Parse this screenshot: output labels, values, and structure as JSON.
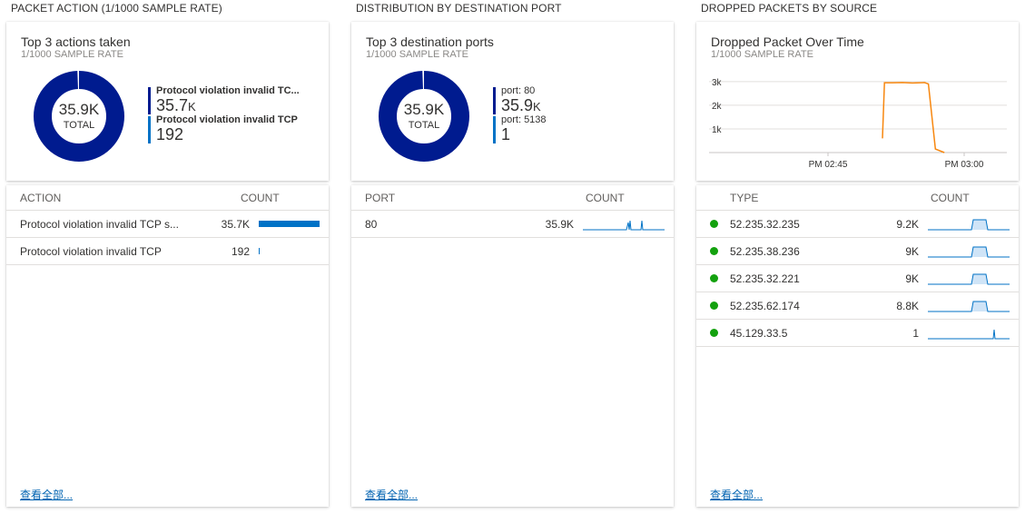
{
  "sections": [
    {
      "title": "PACKET ACTION (1/1000 SAMPLE RATE)",
      "card": {
        "title": "Top 3 actions taken",
        "subtitle": "1/1000 SAMPLE RATE",
        "donut": {
          "value": "35.9K",
          "label": "TOTAL"
        },
        "legend": [
          {
            "name": "Protocol violation invalid TC...",
            "value": "35.7",
            "unit": "K",
            "color": "#001b8f"
          },
          {
            "name": "Protocol violation invalid TCP",
            "value": "192",
            "unit": "",
            "color": "#0072c6"
          }
        ]
      },
      "table": {
        "col1": "ACTION",
        "col2": "COUNT",
        "rows": [
          {
            "name": "Protocol violation invalid TCP s...",
            "count": "35.7K",
            "bar_fraction": 0.995
          },
          {
            "name": "Protocol violation invalid TCP",
            "count": "192",
            "bar_fraction": 0.005
          }
        ],
        "view_all": "查看全部..."
      }
    },
    {
      "title": "DISTRIBUTION BY DESTINATION PORT",
      "card": {
        "title": "Top 3 destination ports",
        "subtitle": "1/1000 SAMPLE RATE",
        "donut": {
          "value": "35.9K",
          "label": "TOTAL"
        },
        "legend": [
          {
            "name": "port: 80",
            "value": "35.9",
            "unit": "K",
            "color": "#001b8f"
          },
          {
            "name": "port: 5138",
            "value": "1",
            "unit": "",
            "color": "#0072c6"
          }
        ]
      },
      "table": {
        "col1": "PORT",
        "col2": "COUNT",
        "rows": [
          {
            "name": "80",
            "count": "35.9K",
            "spark": "port"
          }
        ],
        "view_all": "查看全部..."
      }
    },
    {
      "title": "DROPPED PACKETS BY SOURCE",
      "card": {
        "title": "Dropped Packet Over Time",
        "subtitle": "1/1000 SAMPLE RATE"
      },
      "table": {
        "col1": "TYPE",
        "col2": "COUNT",
        "rows": [
          {
            "name": "52.235.32.235",
            "count": "9.2K",
            "spark": "plateau"
          },
          {
            "name": "52.235.38.236",
            "count": "9K",
            "spark": "plateau"
          },
          {
            "name": "52.235.32.221",
            "count": "9K",
            "spark": "plateau"
          },
          {
            "name": "52.235.62.174",
            "count": "8.8K",
            "spark": "plateau"
          },
          {
            "name": "45.129.33.5",
            "count": "1",
            "spark": "spike"
          }
        ],
        "view_all": "查看全部..."
      }
    }
  ],
  "chart_data": {
    "type": "line",
    "y_ticks": [
      "1k",
      "2k",
      "3k"
    ],
    "ylim": [
      0,
      3300
    ],
    "x_ticks": [
      "PM 02:45",
      "PM 03:00"
    ],
    "series": [
      {
        "color": "#f7870f",
        "points": [
          [
            0.0,
            600
          ],
          [
            0.02,
            2950
          ],
          [
            0.1,
            2950
          ],
          [
            0.2,
            2960
          ],
          [
            0.3,
            2940
          ],
          [
            0.42,
            2960
          ],
          [
            0.46,
            2900
          ],
          [
            0.53,
            150
          ],
          [
            0.62,
            0
          ]
        ]
      }
    ]
  },
  "colors": {
    "donut_primary": "#001b8f",
    "bar": "#0072c6",
    "spark_line": "#0072c6",
    "spark_fill": "#cfe4f7",
    "status_ok": "#13a10e",
    "link": "#0063b1"
  }
}
